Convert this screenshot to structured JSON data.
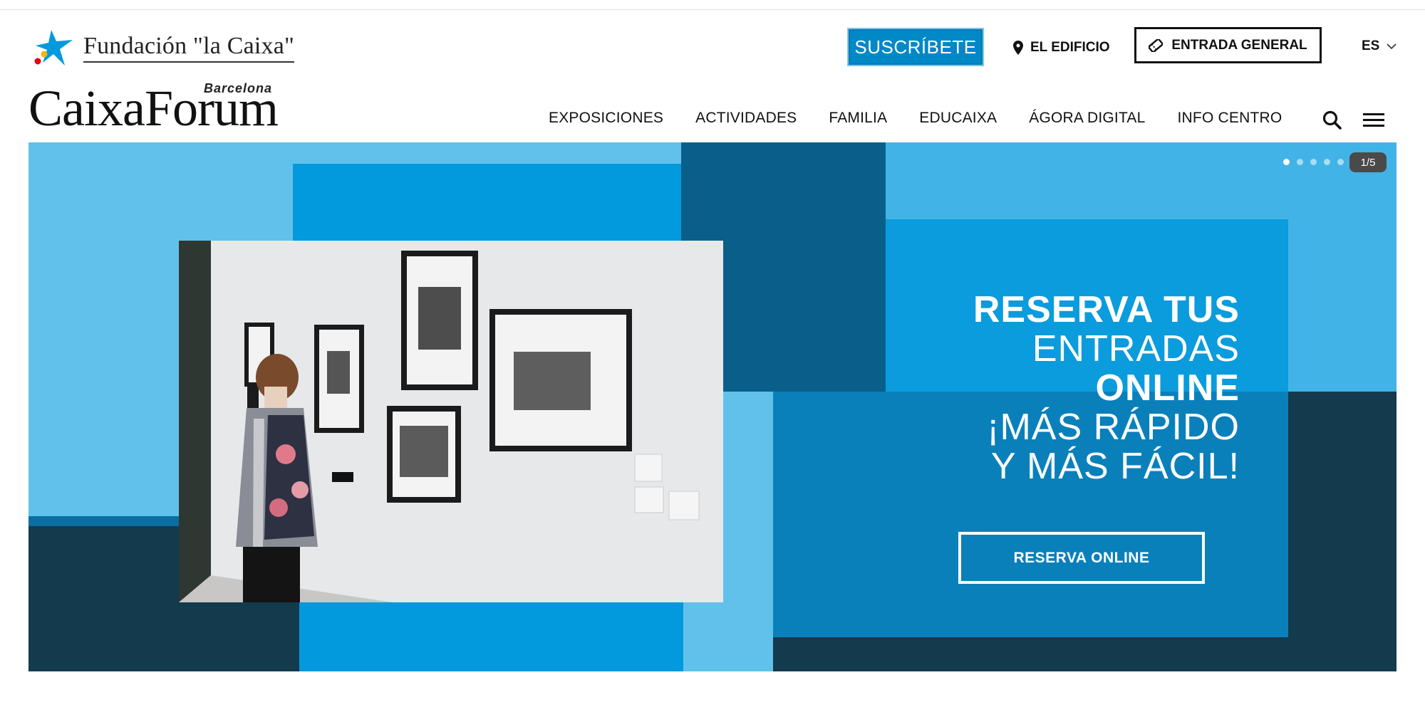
{
  "brand": {
    "fundacion": "Fundación \"la Caixa\"",
    "caixaforum": "CaixaForum",
    "city": "Barcelona"
  },
  "topbar": {
    "subscribe_label": "SUSCRÍBETE",
    "building_label": "EL EDIFICIO",
    "ticket_label": "ENTRADA GENERAL",
    "language": "ES"
  },
  "nav": {
    "items": [
      "EXPOSICIONES",
      "ACTIVIDADES",
      "FAMILIA",
      "EDUCAIXA",
      "ÁGORA DIGITAL",
      "INFO CENTRO"
    ]
  },
  "icons": {
    "location": "location-pin-icon",
    "ticket": "ticket-icon",
    "chevron": "chevron-down-icon",
    "search": "search-icon",
    "menu": "hamburger-menu-icon",
    "star": "caixa-star-logo-icon"
  },
  "hero": {
    "title_lines": [
      "RESERVA TUS",
      "ENTRADAS",
      "ONLINE",
      "¡MÁS RÁPIDO",
      "Y MÁS FÁCIL!"
    ],
    "cta_label": "RESERVA ONLINE",
    "slide_counter": "1/5",
    "slide_count": 5,
    "active_slide": 1
  },
  "colors": {
    "light_blue": "#62c1eb",
    "mid_blue": "#0399dd",
    "sky_blue": "#42b3e6",
    "panel_blue": "#0a80bb",
    "dark_navy": "#133a4d",
    "deep_blue": "#0a5f8a",
    "subscribe_blue": "#0088c7"
  }
}
